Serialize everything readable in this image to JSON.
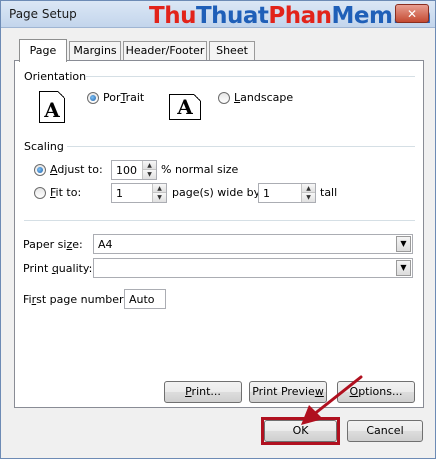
{
  "window": {
    "title": "Page Setup",
    "close_label": "✕"
  },
  "watermark": {
    "part1": "Thu",
    "part2": "Thuat",
    "part3": "Phan",
    "part4": "Mem.vn"
  },
  "tabs": [
    {
      "label": "Page",
      "active": true
    },
    {
      "label": "Margins",
      "active": false
    },
    {
      "label": "Header/Footer",
      "active": false
    },
    {
      "label": "Sheet",
      "active": false
    }
  ],
  "orientation": {
    "section_label": "Orientation",
    "portrait": {
      "icon_glyph": "A",
      "pre": "",
      "mnemonic": "T",
      "post": "",
      "label_prefix": "Por",
      "label_suffix": "rait",
      "checked": true
    },
    "landscape": {
      "icon_glyph": "A",
      "mnemonic": "L",
      "label_suffix": "andscape",
      "checked": false
    }
  },
  "scaling": {
    "section_label": "Scaling",
    "adjust": {
      "mnemonic": "A",
      "label_suffix": "djust to:",
      "value": "100",
      "suffix": "% normal size",
      "checked": true
    },
    "fit": {
      "mnemonic": "F",
      "label_suffix": "it to:",
      "wide_value": "1",
      "wide_suffix": "page(s) wide by",
      "tall_value": "1",
      "tall_suffix": "tall",
      "checked": false
    }
  },
  "paper": {
    "label_prefix": "Paper si",
    "label_mnemonic": "z",
    "label_suffix": "e:",
    "value": "A4"
  },
  "quality": {
    "label_prefix": "Print ",
    "label_mnemonic": "q",
    "label_suffix": "uality:",
    "value": ""
  },
  "first_page": {
    "label_prefix": "Fi",
    "label_mnemonic": "r",
    "label_suffix": "st page number:",
    "value": "Auto"
  },
  "panel_buttons": {
    "print": {
      "prefix": "",
      "mnemonic": "P",
      "suffix": "rint..."
    },
    "preview": {
      "prefix": "Print Previe",
      "mnemonic": "w",
      "suffix": ""
    },
    "options": {
      "prefix": "",
      "mnemonic": "O",
      "suffix": "ptions..."
    }
  },
  "footer": {
    "ok_label": "OK",
    "cancel_label": "Cancel"
  },
  "colors": {
    "annotation_red": "#b0101f",
    "watermark_red": "#e2231a",
    "watermark_blue": "#1f5fb8"
  }
}
